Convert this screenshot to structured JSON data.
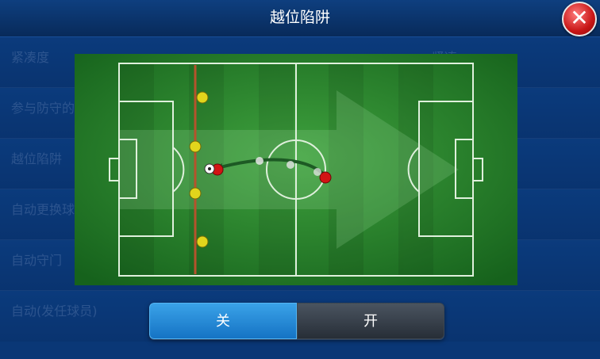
{
  "dialog": {
    "title": "越位陷阱"
  },
  "background_menu": {
    "rows": [
      {
        "label": "紧凑度",
        "value": "紧凑"
      },
      {
        "label": "参与防守的",
        "value": ""
      },
      {
        "label": "越位陷阱",
        "value": ""
      },
      {
        "label": "自动更换球",
        "value": ""
      },
      {
        "label": "自动守门",
        "value": ""
      },
      {
        "label": "自动(发任球员)",
        "value": ""
      }
    ]
  },
  "toggle": {
    "off_label": "关",
    "on_label": "开",
    "selected": "off"
  },
  "colors": {
    "toggle_selected": "#1f86d8",
    "toggle_unselected": "#2f3741",
    "pitch_green": "#2f8f32",
    "offside_line": "#b5532c",
    "defender": "#e1d51c",
    "attacker": "#d21414"
  }
}
